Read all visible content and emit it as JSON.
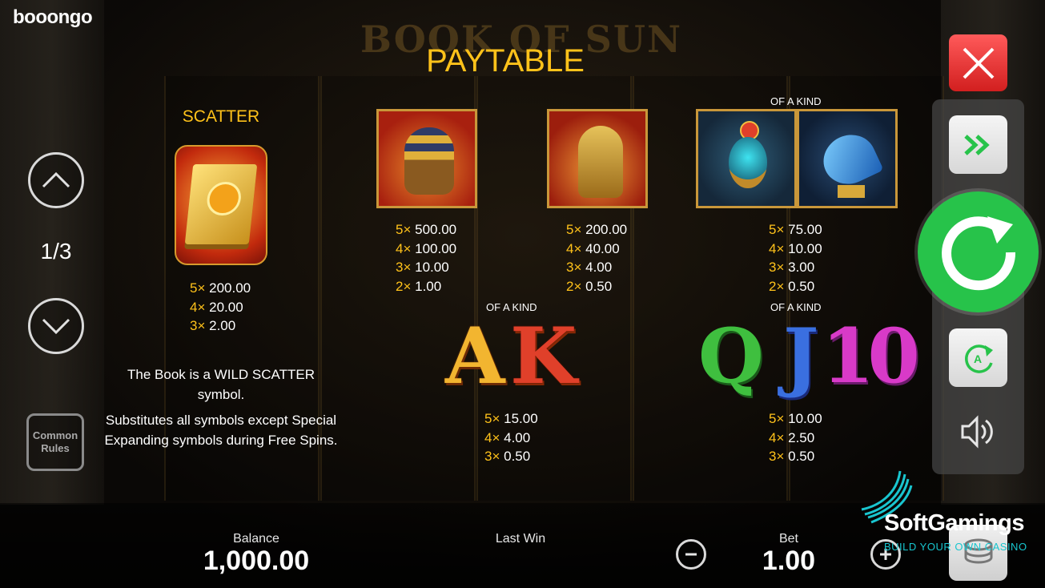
{
  "brand": "booongo",
  "game_logo": "BOOK OF SUN",
  "title": "PAYTABLE",
  "page_indicator": "1/3",
  "common_rules": "Common Rules",
  "scatter": {
    "label": "SCATTER",
    "payouts": [
      {
        "mult": "5×",
        "value": "200.00"
      },
      {
        "mult": "4×",
        "value": "20.00"
      },
      {
        "mult": "3×",
        "value": "2.00"
      }
    ]
  },
  "description": {
    "line1": "The Book is a WILD SCATTER symbol.",
    "line2": "Substitutes all symbols except Special Expanding symbols during Free Spins."
  },
  "pharaoh": {
    "payouts": [
      {
        "mult": "5×",
        "value": "500.00"
      },
      {
        "mult": "4×",
        "value": "100.00"
      },
      {
        "mult": "3×",
        "value": "10.00"
      },
      {
        "mult": "2×",
        "value": "1.00"
      }
    ]
  },
  "horus": {
    "payouts": [
      {
        "mult": "5×",
        "value": "200.00"
      },
      {
        "mult": "4×",
        "value": "40.00"
      },
      {
        "mult": "3×",
        "value": "4.00"
      },
      {
        "mult": "2×",
        "value": "0.50"
      }
    ]
  },
  "scarab_bird": {
    "of_a_kind": "OF A KIND",
    "payouts": [
      {
        "mult": "5×",
        "value": "75.00"
      },
      {
        "mult": "4×",
        "value": "10.00"
      },
      {
        "mult": "3×",
        "value": "3.00"
      },
      {
        "mult": "2×",
        "value": "0.50"
      }
    ]
  },
  "ak": {
    "of_a_kind": "OF A KIND",
    "letters": [
      "A",
      "K"
    ],
    "payouts": [
      {
        "mult": "5×",
        "value": "15.00"
      },
      {
        "mult": "4×",
        "value": "4.00"
      },
      {
        "mult": "3×",
        "value": "0.50"
      }
    ]
  },
  "qj10": {
    "of_a_kind": "OF A KIND",
    "letters": [
      "Q",
      "J",
      "10"
    ],
    "payouts": [
      {
        "mult": "5×",
        "value": "10.00"
      },
      {
        "mult": "4×",
        "value": "2.50"
      },
      {
        "mult": "3×",
        "value": "0.50"
      }
    ]
  },
  "footer": {
    "balance_label": "Balance",
    "balance_value": "1,000.00",
    "last_win_label": "Last Win",
    "bet_label": "Bet",
    "bet_value": "1.00"
  },
  "watermark": {
    "name": "SoftGamings",
    "tagline": "BUILD YOUR OWN CASINO"
  },
  "colors": {
    "gold": "#ffc21a",
    "close_red": "#e02b2b",
    "spin_green": "#27c34a"
  },
  "icons": [
    "up-arrow-icon",
    "down-arrow-icon",
    "close-icon",
    "fast-forward-icon",
    "spin-icon",
    "autoplay-icon",
    "sound-icon",
    "minus-icon",
    "plus-icon",
    "coins-icon"
  ]
}
